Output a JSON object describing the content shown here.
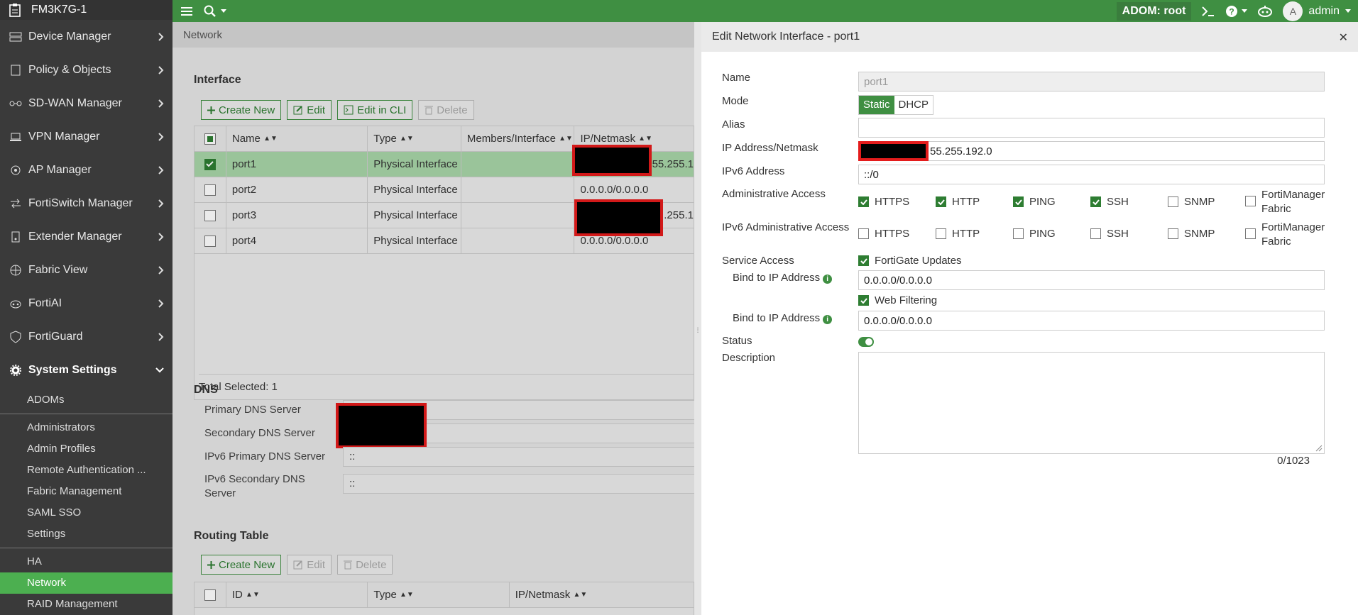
{
  "device_name": "FM3K7G-1",
  "sidebar": {
    "items": [
      {
        "label": "Device Manager"
      },
      {
        "label": "Policy & Objects"
      },
      {
        "label": "SD-WAN Manager"
      },
      {
        "label": "VPN Manager"
      },
      {
        "label": "AP Manager"
      },
      {
        "label": "FortiSwitch Manager"
      },
      {
        "label": "Extender Manager"
      },
      {
        "label": "Fabric View"
      },
      {
        "label": "FortiAI"
      },
      {
        "label": "FortiGuard"
      },
      {
        "label": "System Settings"
      }
    ],
    "sub": {
      "adoms": "ADOMs",
      "administrators": "Administrators",
      "admin_profiles": "Admin Profiles",
      "remote_auth": "Remote Authentication ...",
      "fabric_mgmt": "Fabric Management",
      "saml": "SAML SSO",
      "settings": "Settings",
      "ha": "HA",
      "network": "Network",
      "raid": "RAID Management"
    }
  },
  "topbar": {
    "adom": "ADOM: root",
    "user": "admin",
    "avatar_letter": "A"
  },
  "main": {
    "breadcrumb": "Network",
    "interface": {
      "title": "Interface",
      "create_new": "Create New",
      "edit": "Edit",
      "edit_cli": "Edit in CLI",
      "delete": "Delete",
      "headers": [
        "Name",
        "Type",
        "Members/Interface",
        "IP/Netmask"
      ],
      "rows": [
        {
          "name": "port1",
          "type": "Physical Interface",
          "ip": "55.255.1"
        },
        {
          "name": "port2",
          "type": "Physical Interface",
          "ip": "0.0.0.0/0.0.0.0"
        },
        {
          "name": "port3",
          "type": "Physical Interface",
          "ip": ".255.1"
        },
        {
          "name": "port4",
          "type": "Physical Interface",
          "ip": "0.0.0.0/0.0.0.0"
        }
      ],
      "total": "Total Selected: 1"
    },
    "dns": {
      "title": "DNS",
      "primary": "Primary DNS Server",
      "secondary": "Secondary DNS Server",
      "ipv6_primary": "IPv6 Primary DNS Server",
      "ipv6_primary_value": "::",
      "ipv6_secondary": "IPv6 Secondary DNS Server",
      "ipv6_secondary_value": "::"
    },
    "routing": {
      "title": "Routing Table",
      "create_new": "Create New",
      "edit": "Edit",
      "delete": "Delete",
      "headers": [
        "ID",
        "Type",
        "IP/Netmask"
      ]
    }
  },
  "drawer": {
    "title": "Edit Network Interface - port1",
    "name_label": "Name",
    "name_value": "port1",
    "mode_label": "Mode",
    "mode_static": "Static",
    "mode_dhcp": "DHCP",
    "alias_label": "Alias",
    "ip_label": "IP Address/Netmask",
    "ip_value": "55.255.192.0",
    "ipv6_label": "IPv6 Address",
    "ipv6_value": "::/0",
    "admin_access_label": "Administrative Access",
    "ipv6_admin_access_label": "IPv6 Administrative Access",
    "access_opts": [
      "HTTPS",
      "HTTP",
      "PING",
      "SSH",
      "SNMP",
      "FortiManager Fabric"
    ],
    "service_access_label": "Service Access",
    "fortigate_updates": "FortiGate Updates",
    "bind_label": "Bind to IP Address",
    "bind_value_1": "0.0.0.0/0.0.0.0",
    "web_filtering": "Web Filtering",
    "bind_value_2": "0.0.0.0/0.0.0.0",
    "status_label": "Status",
    "description_label": "Description",
    "counter": "0/1023"
  }
}
